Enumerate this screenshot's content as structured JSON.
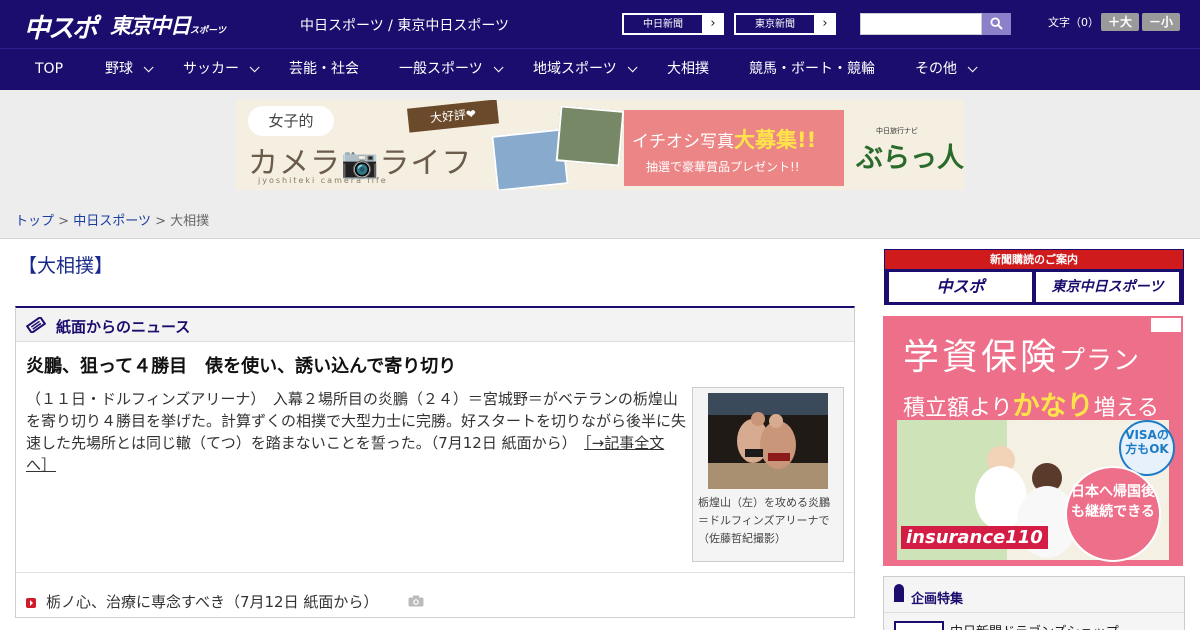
{
  "header": {
    "logo_chuspo": "中スポ",
    "logo_tokyo": "東京中日",
    "logo_tokyo_small": "スポーツ",
    "site_names": "中日スポーツ / 東京中日スポーツ",
    "ext_links": [
      {
        "label": "中日新聞"
      },
      {
        "label": "東京新聞"
      }
    ],
    "search": {
      "value": "",
      "placeholder": ""
    },
    "search_icon": "search-icon",
    "font_size_label": "文字（0）",
    "font_increase": "＋大",
    "font_decrease": "－小",
    "brand_color": "#1a0d6e"
  },
  "nav": {
    "items": [
      {
        "label": "TOP",
        "has_dropdown": false
      },
      {
        "label": "野球",
        "has_dropdown": true
      },
      {
        "label": "サッカー",
        "has_dropdown": true
      },
      {
        "label": "芸能・社会",
        "has_dropdown": false
      },
      {
        "label": "一般スポーツ",
        "has_dropdown": true
      },
      {
        "label": "地域スポーツ",
        "has_dropdown": true
      },
      {
        "label": "大相撲",
        "has_dropdown": false
      },
      {
        "label": "競馬・ボート・競輪",
        "has_dropdown": false
      },
      {
        "label": "その他",
        "has_dropdown": true
      }
    ]
  },
  "banner_ad": {
    "bubble": "女子的",
    "title": "カメラ📷ライフ",
    "subtitle": "jyoshiteki camera life",
    "tag": "大好評❤",
    "line1_prefix": "イチオシ写真",
    "line1_highlight": "大募集!!",
    "line2": "抽選で豪華賞品プレゼント!!",
    "brand_small": "中日旅行ナビ",
    "brand": "ぶらっ人"
  },
  "breadcrumb": {
    "items": [
      "トップ",
      "中日スポーツ",
      "大相撲"
    ],
    "separator": ">"
  },
  "main": {
    "page_title": "【大相撲】",
    "news_section": {
      "heading": "紙面からのニュース",
      "headline": "炎鵬、狙って４勝目　俵を使い、誘い込んで寄り切り",
      "summary": "（１１日・ドルフィンズアリーナ）　入幕２場所目の炎鵬（２４）＝宮城野＝がベテランの栃煌山を寄り切り４勝目を挙げた。計算ずくの相撲で大型力士に完勝。好スタートを切りながら後半に失速した先場所とは同じ轍（てつ）を踏まないことを誓った。（7月12日 紙面から）",
      "more_link": "［→記事全文へ］",
      "photo_caption": "栃煌山（左）を攻める炎鵬＝ドルフィンズアリーナで（佐藤哲紀撮影）",
      "sub_link": "栃ノ心、治療に専念すべき（7月12日 紙面から）"
    }
  },
  "sidebar": {
    "subscribe_title": "新聞購読のご案内",
    "subscribe_logos": [
      "中スポ",
      "東京中日スポーツ"
    ],
    "ad": {
      "title": "学資保険",
      "title_suffix": "プラン",
      "line_prefix": "積立額より",
      "line_highlight": "かなり",
      "line_suffix": "増える",
      "visa": "VISAの方もOK",
      "circle": "日本へ帰国後も継続できる",
      "brand": "insurance110"
    },
    "feature": {
      "heading": "企画特集",
      "item": "中日新聞ドラゴンズショップ"
    }
  }
}
